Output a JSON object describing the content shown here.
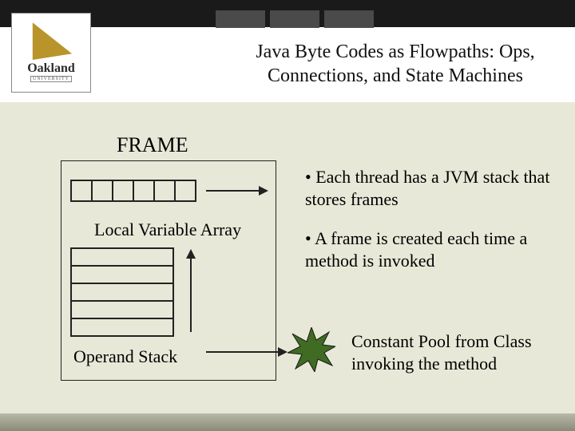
{
  "logo": {
    "name": "Oakland",
    "sub": "UNIVERSITY"
  },
  "title": "Java Byte Codes as Flowpaths: Ops, Connections, and State Machines",
  "frame": {
    "heading": "FRAME",
    "local_variable_array_label": "Local Variable Array",
    "operand_stack_label": "Operand Stack",
    "lva_cell_count": 6,
    "operand_stack_rows": 5
  },
  "bullets": [
    "Each thread has a JVM stack that stores frames",
    "A frame is created each time a method is invoked"
  ],
  "constant_pool_text": "Constant Pool from Class invoking the method",
  "colors": {
    "accent": "#3a8a1a",
    "burst_fill": "#38621a"
  }
}
